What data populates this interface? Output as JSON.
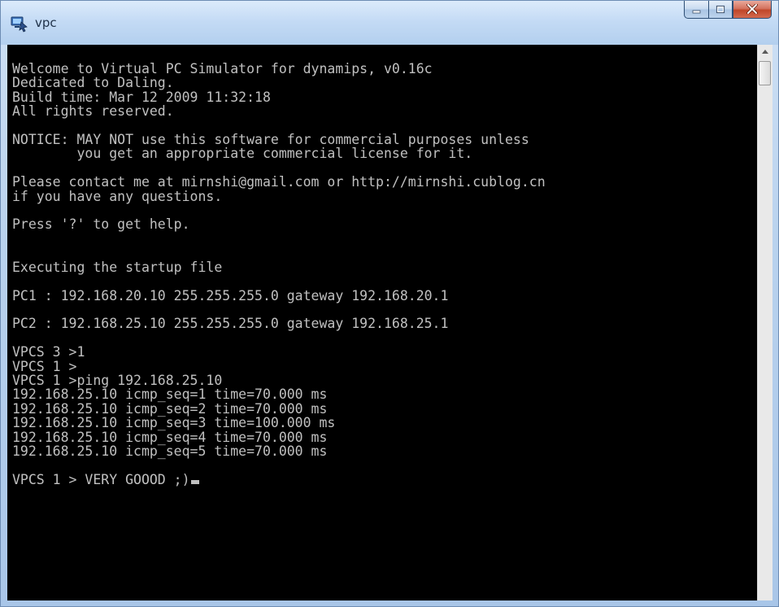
{
  "window": {
    "title": "vpc",
    "icon": "vpc-app-icon"
  },
  "caption_buttons": {
    "minimize_icon": "minimize-icon",
    "maximize_icon": "maximize-icon",
    "close_icon": "close-icon"
  },
  "console": {
    "lines": [
      "Welcome to Virtual PC Simulator for dynamips, v0.16c",
      "Dedicated to Daling.",
      "Build time: Mar 12 2009 11:32:18",
      "All rights reserved.",
      "",
      "NOTICE: MAY NOT use this software for commercial purposes unless",
      "        you get an appropriate commercial license for it.",
      "",
      "Please contact me at mirnshi@gmail.com or http://mirnshi.cublog.cn",
      "if you have any questions.",
      "",
      "Press '?' to get help.",
      "",
      "",
      "Executing the startup file",
      "",
      "PC1 : 192.168.20.10 255.255.255.0 gateway 192.168.20.1",
      "",
      "PC2 : 192.168.25.10 255.255.255.0 gateway 192.168.25.1",
      "",
      "VPCS 3 >1",
      "VPCS 1 >",
      "VPCS 1 >ping 192.168.25.10",
      "192.168.25.10 icmp_seq=1 time=70.000 ms",
      "192.168.25.10 icmp_seq=2 time=70.000 ms",
      "192.168.25.10 icmp_seq=3 time=100.000 ms",
      "192.168.25.10 icmp_seq=4 time=70.000 ms",
      "192.168.25.10 icmp_seq=5 time=70.000 ms",
      "",
      "VPCS 1 > VERY GOOOD ;)"
    ],
    "background": "#000000",
    "text_color": "#c0c0c0"
  },
  "scrollbar": {
    "up_icon": "scroll-up-arrow-icon",
    "down_icon": "scroll-down-arrow-icon"
  }
}
